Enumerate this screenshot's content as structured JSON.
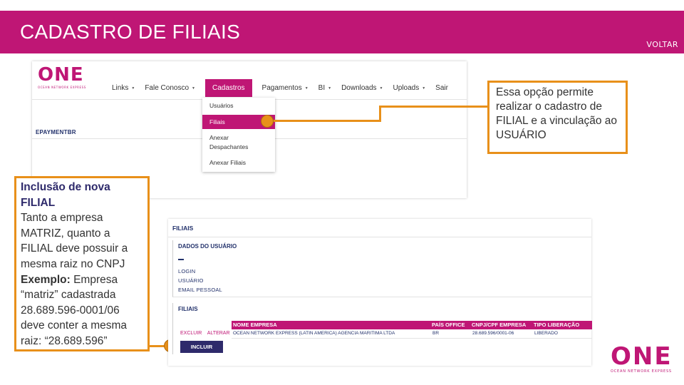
{
  "header": {
    "title": "CADASTRO DE FILIAIS",
    "back_label": "VOLTAR"
  },
  "colors": {
    "brand": "#bf1675",
    "accent": "#e8901a",
    "navy": "#2e2a6b"
  },
  "portal": {
    "logo_text": "ONE",
    "logo_subtitle": "OCEAN NETWORK EXPRESS",
    "nav": [
      {
        "label": "Links"
      },
      {
        "label": "Fale Conosco"
      },
      {
        "label": "Cadastros"
      },
      {
        "label": "Pagamentos"
      },
      {
        "label": "BI"
      },
      {
        "label": "Downloads"
      },
      {
        "label": "Uploads"
      },
      {
        "label": "Sair"
      }
    ],
    "page_label": "EPAYMENTBR",
    "dropdown": [
      {
        "label": "Usuários"
      },
      {
        "label": "Filiais"
      },
      {
        "label": "Anexar"
      },
      {
        "label": "Despachantes"
      },
      {
        "label": "Anexar Filiais"
      }
    ]
  },
  "callout_right": {
    "text": "Essa opção permite realizar o cadastro de FILIAL e a vinculação ao USUÁRIO"
  },
  "callout_left": {
    "heading": "Inclusão de nova FILIAL",
    "body": "Tanto a empresa MATRIZ, quanto a FILIAL deve possuir a mesma raiz no CNPJ",
    "example_label": "Exemplo:",
    "example_text": "Empresa “matriz” cadastrada 28.689.596-0001/06 deve conter a mesma raiz: “28.689.596”"
  },
  "filiais_screen": {
    "title": "FILIAIS",
    "user_section": {
      "title": "DADOS DO USUÁRIO",
      "fields": [
        "LOGIN",
        "USUÁRIO",
        "EMAIL PESSOAL"
      ]
    },
    "branches_section": {
      "title": "FILIAIS",
      "columns": [
        "NOME EMPRESA",
        "PAÍS OFFICE",
        "CNPJ/CPF EMPRESA",
        "TIPO LIBERAÇÃO"
      ],
      "row_actions": [
        "EXCLUIR",
        "ALTERAR"
      ],
      "rows": [
        [
          "OCEAN NETWORK EXPRESS (LATIN AMERICA) AGENCIA MARITIMA LTDA",
          "BR",
          "28.689.596/0001-06",
          "LIBERADO"
        ]
      ],
      "add_button": "INCLUIR"
    }
  },
  "brand_logo": {
    "text": "ONE",
    "subtitle": "OCEAN NETWORK EXPRESS"
  }
}
